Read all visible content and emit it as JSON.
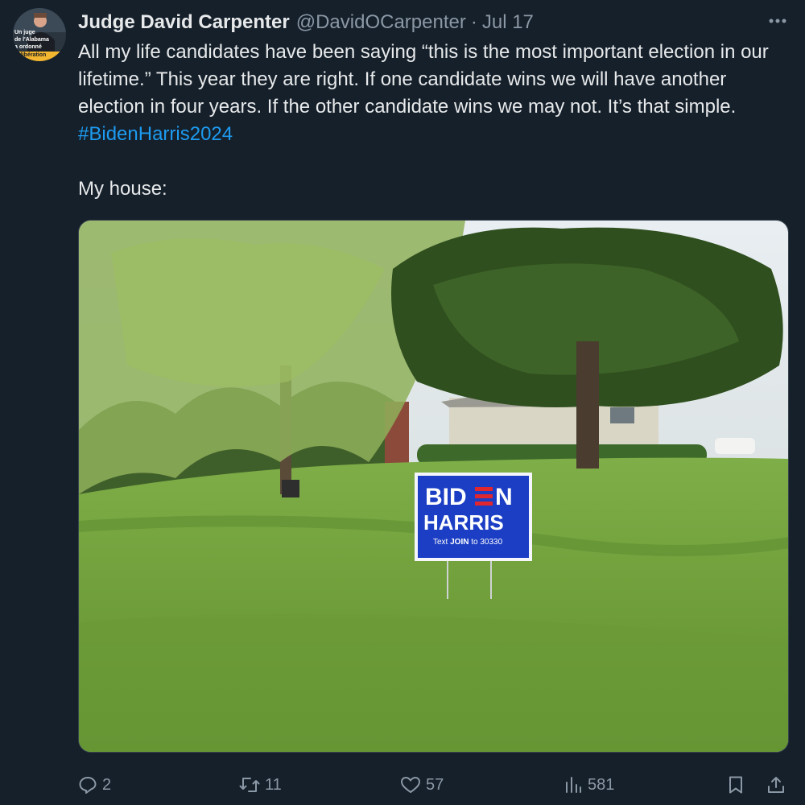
{
  "author": {
    "display_name": "Judge David Carpenter",
    "handle": "@DavidOCarpenter",
    "separator": "·",
    "date": "Jul 17",
    "avatar_caption": [
      "Un juge",
      "de l'Alabama",
      "a ordonné",
      "la libération"
    ]
  },
  "tweet": {
    "text_line1": "All my life candidates have been saying “this is the most important election in our lifetime.”  This year they are right. If one candidate wins we will have another election in four years. If the other candidate wins we may not. It’s that simple. ",
    "hashtag": "#BidenHarris2024",
    "text_line2": "My house:"
  },
  "media": {
    "sign": {
      "line1_left": "BID",
      "line1_right": "N",
      "line2": "HARRIS",
      "line3_prefix": "Text ",
      "line3_keyword": "JOIN",
      "line3_suffix": " to 30330"
    },
    "colors": {
      "sign_blue": "#1b3ec4",
      "sign_red": "#e0262f",
      "grass": "#6f9e3a"
    }
  },
  "actions": {
    "replies": "2",
    "retweets": "11",
    "likes": "57",
    "views": "581"
  },
  "icons": [
    "reply-icon",
    "retweet-icon",
    "like-icon",
    "views-icon",
    "bookmark-icon",
    "share-icon",
    "more-icon"
  ]
}
